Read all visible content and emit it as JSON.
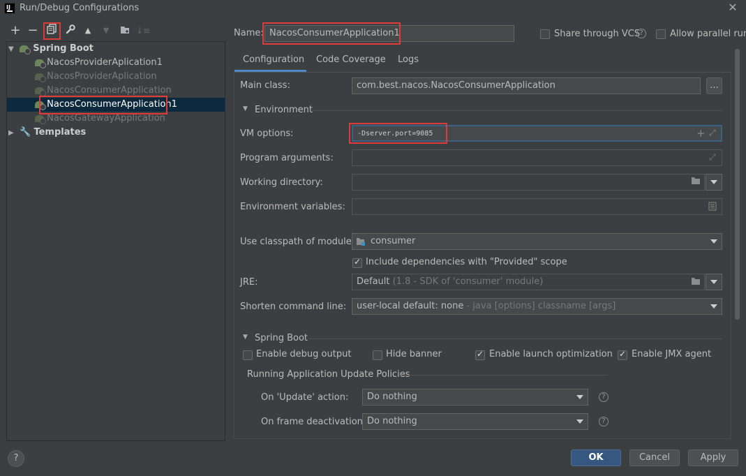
{
  "window": {
    "title": "Run/Debug Configurations",
    "logo_text": "IJ"
  },
  "toolbar": {
    "icons": [
      "add-icon",
      "remove-icon",
      "copy-icon",
      "wrench-icon",
      "move-up-icon",
      "move-down-icon",
      "folder-add-icon",
      "sort-icon"
    ]
  },
  "tree": {
    "spring_boot": "Spring Boot",
    "items": [
      "NacosProviderAplication1",
      "NacosProviderAplication",
      "NacosConsumerApplication",
      "NacosConsumerApplication1",
      "NacosGatewayApplication"
    ],
    "templates": "Templates"
  },
  "header": {
    "name_label": "Name:",
    "name_value": "NacosConsumerApplication1",
    "share_label": "Share through VCS",
    "parallel_label": "Allow parallel run"
  },
  "tabs": [
    "Configuration",
    "Code Coverage",
    "Logs"
  ],
  "form": {
    "main_class_label": "Main class:",
    "main_class_value": "com.best.nacos.NacosConsumerApplication",
    "browse_label": "...",
    "environment_label": "Environment",
    "vm_label": "VM options:",
    "vm_value": "-Dserver.port=9085",
    "program_args_label": "Program arguments:",
    "working_dir_label": "Working directory:",
    "env_vars_label": "Environment variables:",
    "classpath_label": "Use classpath of module:",
    "classpath_value": "consumer",
    "include_deps_label": "Include dependencies with \"Provided\" scope",
    "jre_label": "JRE:",
    "jre_value": "Default",
    "jre_hint": "(1.8 - SDK of 'consumer' module)",
    "shorten_label": "Shorten command line:",
    "shorten_value": "user-local default: none",
    "shorten_hint": "- java [options] classname [args]"
  },
  "spring": {
    "section_label": "Spring Boot",
    "debug_output": "Enable debug output",
    "hide_banner": "Hide banner",
    "launch_opt": "Enable launch optimization",
    "jmx": "Enable JMX agent",
    "policies_label": "Running Application Update Policies",
    "update_label": "On 'Update' action:",
    "update_value": "Do nothing",
    "frame_label": "On frame deactivation:",
    "frame_value": "Do nothing"
  },
  "footer": {
    "help": "?",
    "ok": "OK",
    "cancel": "Cancel",
    "apply": "Apply"
  },
  "colors": {
    "accent": "#365880",
    "selection": "#0d293e",
    "highlight_box": "#e03b3b"
  }
}
